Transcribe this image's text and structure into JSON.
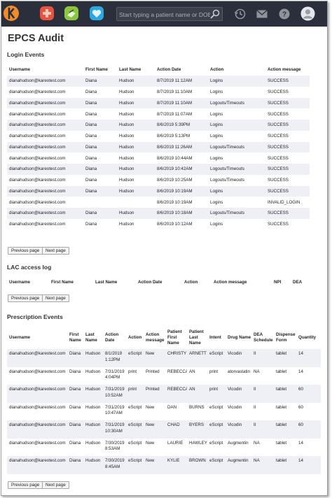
{
  "topbar": {
    "search_placeholder": "Start typing a patient name or DOB",
    "icons": [
      "kareo-logo-icon",
      "medical-cross-icon",
      "billing-icon",
      "heart-icon",
      "history-icon",
      "mail-icon",
      "help-icon",
      "user-avatar-icon"
    ],
    "colors": {
      "bar": "#2a2f3b",
      "orange": "#f28c28",
      "red": "#e9523e",
      "green": "#8cc63f",
      "blue": "#29a9e0"
    }
  },
  "page_title": "EPCS Audit",
  "login_events": {
    "title": "Login Events",
    "columns": [
      "Username",
      "First Name",
      "Last Name",
      "Action Date",
      "Action",
      "Action message"
    ],
    "rows": [
      [
        "dianahudson@kareotest.com",
        "Diana",
        "Hudson",
        "8/7/2019 11:12AM",
        "Logins",
        "SUCCESS"
      ],
      [
        "dianahudson@kareotest.com",
        "Diana",
        "Hudson",
        "8/7/2019 11:10AM",
        "Logins",
        "SUCCESS"
      ],
      [
        "dianahudson@kareotest.com",
        "Diana",
        "Hudson",
        "8/7/2019 11:10AM",
        "Logouts/Timeouts",
        "SUCCESS"
      ],
      [
        "dianahudson@kareotest.com",
        "Diana",
        "Hudson",
        "8/7/2019 11:07AM",
        "Logins",
        "SUCCESS"
      ],
      [
        "dianahudson@kareotest.com",
        "Diana",
        "Hudson",
        "8/6/2019 5:39PM",
        "Logins",
        "SUCCESS"
      ],
      [
        "dianahudson@kareotest.com",
        "Diana",
        "Hudson",
        "8/6/2019 5:13PM",
        "Logins",
        "SUCCESS"
      ],
      [
        "dianahudson@kareotest.com",
        "Diana",
        "Hudson",
        "8/6/2019 11:26AM",
        "Logouts/Timeouts",
        "SUCCESS"
      ],
      [
        "dianahudson@kareotest.com",
        "Diana",
        "Hudson",
        "8/6/2019 10:44AM",
        "Logins",
        "SUCCESS"
      ],
      [
        "dianahudson@kareotest.com",
        "Diana",
        "Hudson",
        "8/6/2019 10:42AM",
        "Logouts/Timeouts",
        "SUCCESS"
      ],
      [
        "dianahudson@kareotest.com",
        "Diana",
        "Hudson",
        "8/6/2019 10:25AM",
        "Logouts/Timeouts",
        "SUCCESS"
      ],
      [
        "dianahudson@kareotest.com",
        "Diana",
        "Hudson",
        "8/6/2019 10:19AM",
        "Logins",
        "SUCCESS"
      ],
      [
        "dianahudson@kareotest.com",
        "",
        "",
        "8/6/2019 10:19AM",
        "Logins",
        "INVALID_LOGIN"
      ],
      [
        "dianahudson@kareotest.com",
        "Diana",
        "Hudson",
        "8/6/2019 10:18AM",
        "Logouts/Timeouts",
        "SUCCESS"
      ],
      [
        "dianahudson@kareotest.com",
        "Diana",
        "Hudson",
        "8/6/2019 10:12AM",
        "Logins",
        "SUCCESS"
      ]
    ],
    "prev_label": "Previous page",
    "next_label": "Next page"
  },
  "lac_log": {
    "title": "LAC access log",
    "columns": [
      "Username",
      "First Name",
      "Last Name",
      "Action Date",
      "Action",
      "Action message",
      "NPI",
      "DEA"
    ],
    "prev_label": "Previous page",
    "next_label": "Next page"
  },
  "prescription_events": {
    "title": "Prescription Events",
    "columns": [
      "Username",
      "First Name",
      "Last Name",
      "Action Date",
      "Action",
      "Action message",
      "Patient First Name",
      "Patient Last Name",
      "Intent",
      "Drug Name",
      "DEA Schedule",
      "Dispense Form",
      "Quantity"
    ],
    "rows": [
      [
        "dianahudson@kareotest.com",
        "Diana",
        "Hudson",
        "8/1/2019 1:12PM",
        "eScript",
        "New",
        "CHRISTY",
        "ARNETT",
        "eScript",
        "Vicodin",
        "II",
        "tablet",
        "14"
      ],
      [
        "dianahudson@kareotest.com",
        "Diana",
        "Hudson",
        "7/31/2019 4:04PM",
        "print",
        "Printed",
        "REBECCA",
        "AN",
        "print",
        "atorvastatin",
        "NA",
        "tablet",
        "14"
      ],
      [
        "dianahudson@kareotest.com",
        "Diana",
        "Hudson",
        "7/31/2019 10:52AM",
        "print",
        "Printed",
        "REBECCA",
        "AN",
        "print",
        "Vicodin",
        "II",
        "tablet",
        "60"
      ],
      [
        "dianahudson@kareotest.com",
        "Diana",
        "Hudson",
        "7/31/2019 10:47AM",
        "eScript",
        "New",
        "DAN",
        "BURNS",
        "eScript",
        "Vicodin",
        "II",
        "tablet",
        "60"
      ],
      [
        "dianahudson@kareotest.com",
        "Diana",
        "Hudson",
        "7/31/2019 10:30AM",
        "eScript",
        "New",
        "CHAD",
        "BYERS",
        "eScript",
        "Vicodin",
        "II",
        "tablet",
        "60"
      ],
      [
        "dianahudson@kareotest.com",
        "Diana",
        "Hudson",
        "7/30/2019 8:53AM",
        "eScript",
        "New",
        "LAURIE",
        "HAWLEY",
        "eScript",
        "Augmentin",
        "NA",
        "tablet",
        "14"
      ],
      [
        "dianahudson@kareotest.com",
        "Diana",
        "Hudson",
        "7/30/2019 8:45AM",
        "eScript",
        "New",
        "KYLIE",
        "BROWN",
        "eScript",
        "Augmentin",
        "NA",
        "tablet",
        "14"
      ]
    ],
    "prev_label": "Previous page",
    "next_label": "Next page"
  }
}
